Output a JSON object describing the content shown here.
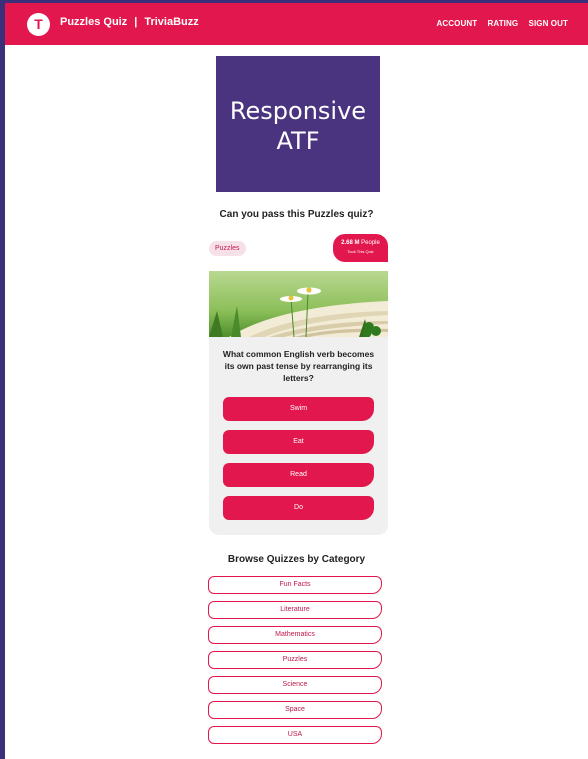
{
  "header": {
    "logo_letter": "T",
    "site_section": "Puzzles Quiz",
    "separator": "|",
    "brand": "TriviaBuzz",
    "nav": [
      "ACCOUNT",
      "RATING",
      "SIGN OUT"
    ]
  },
  "ad": {
    "line1": "Responsive",
    "line2": "ATF"
  },
  "quiz": {
    "title": "Can you pass this Puzzles quiz?",
    "category": "Puzzles",
    "takers_count": "2.68 M",
    "takers_label": "People",
    "took_text": "Took This Quiz",
    "question": "What common English verb becomes its own past tense by rearranging its letters?",
    "answers": [
      "Swim",
      "Eat",
      "Read",
      "Do"
    ]
  },
  "browse": {
    "title": "Browse Quizzes by Category",
    "categories": [
      "Fun Facts",
      "Literature",
      "Mathematics",
      "Puzzles",
      "Science",
      "Space",
      "USA"
    ]
  },
  "colors": {
    "accent": "#e2174d",
    "frame": "#3b2f7a",
    "ad_background": "#4a3480",
    "card_background": "#f0f0f0"
  }
}
